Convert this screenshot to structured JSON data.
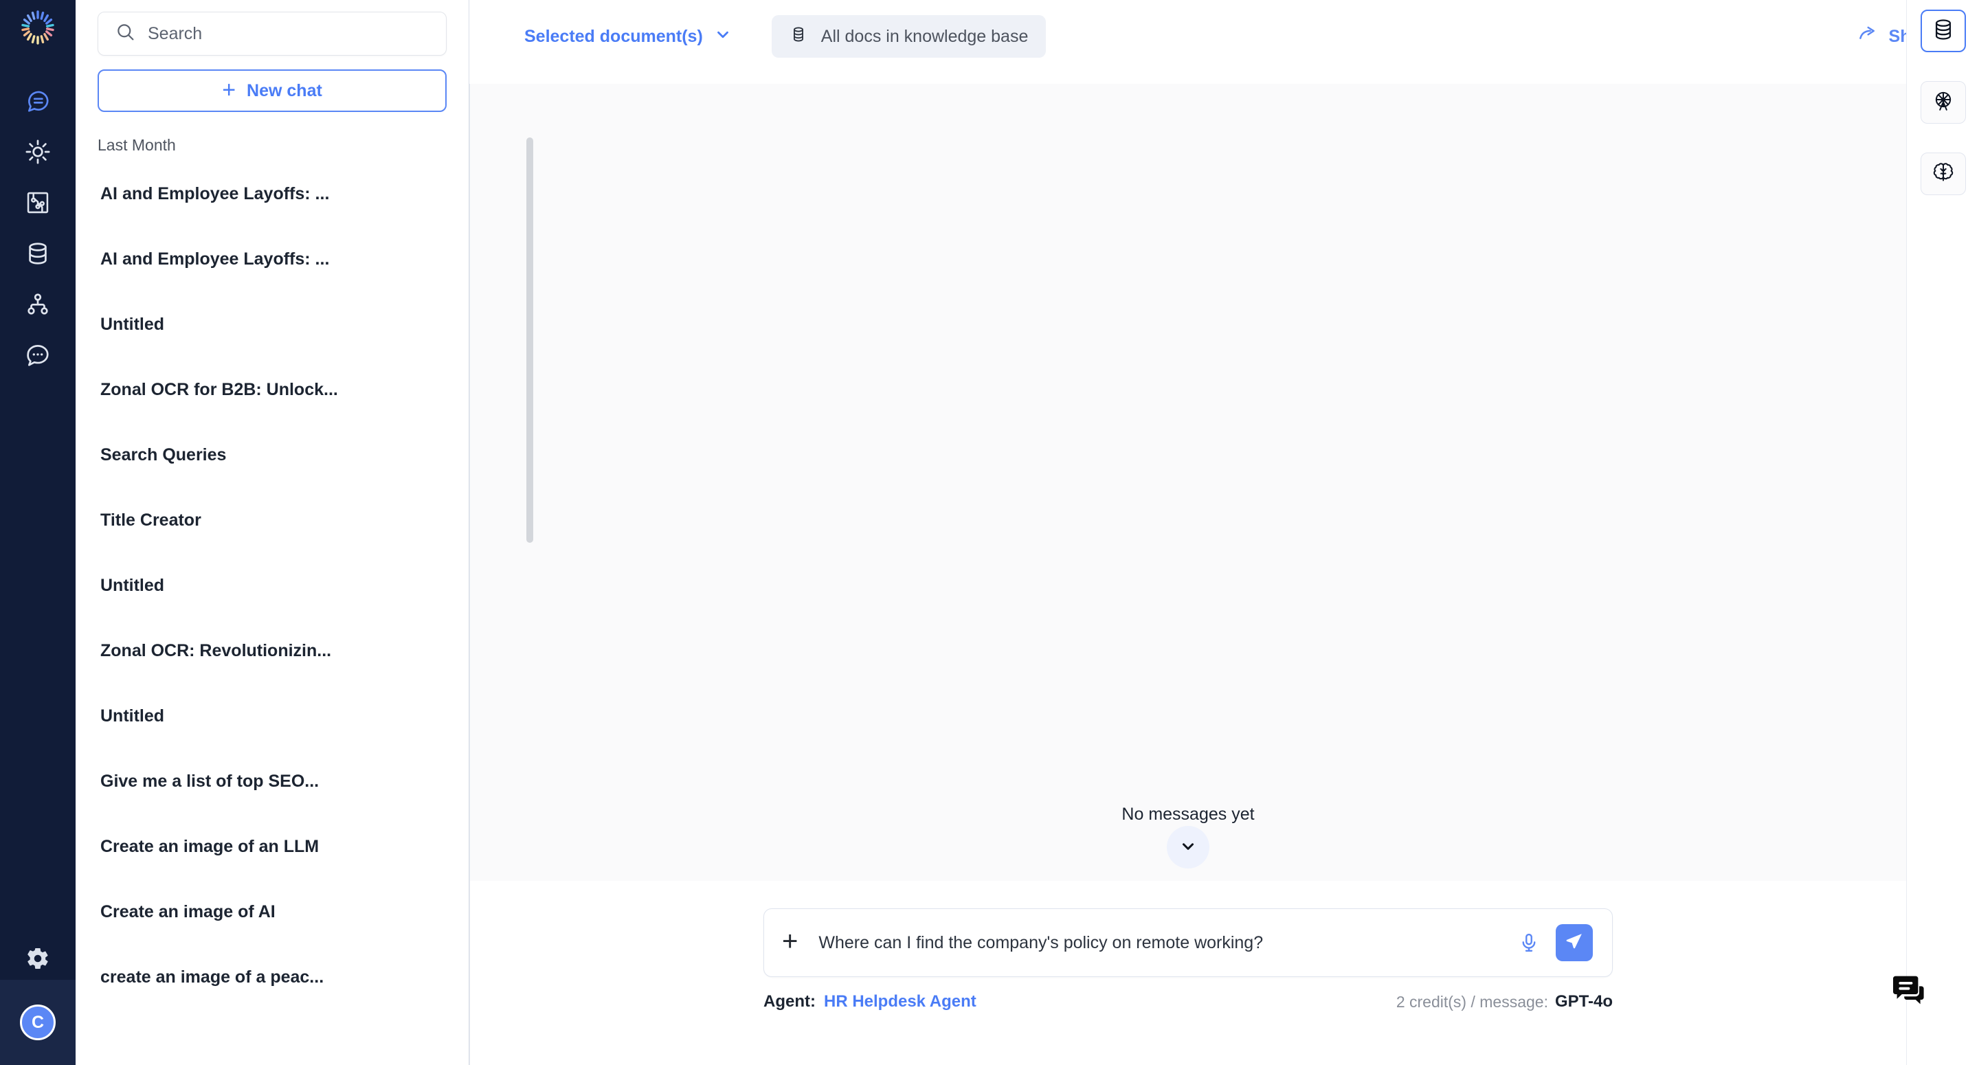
{
  "brand": {
    "logo_icon": "radial-burst-logo",
    "accent": "#4a7cf6",
    "rail_bg": "#111c38"
  },
  "rail": {
    "items": [
      {
        "icon": "chat-lines-icon",
        "name": "nav-chat",
        "active": true
      },
      {
        "icon": "sun-spark-icon",
        "name": "nav-automations",
        "active": false
      },
      {
        "icon": "circuit-board-icon",
        "name": "nav-workflows",
        "active": false
      },
      {
        "icon": "database-icon",
        "name": "nav-knowledge-base",
        "active": false
      },
      {
        "icon": "org-tree-icon",
        "name": "nav-agents",
        "active": false
      },
      {
        "icon": "chat-dots-icon",
        "name": "nav-conversations",
        "active": false
      }
    ],
    "settings_icon": "gear-icon",
    "avatar_initial": "C"
  },
  "search": {
    "placeholder": "Search",
    "value": "",
    "icon": "search-icon"
  },
  "new_chat": {
    "label": "New chat",
    "icon": "plus-icon"
  },
  "chat_history": {
    "section_label": "Last Month",
    "items": [
      {
        "title": "AI and Employee Layoffs: ..."
      },
      {
        "title": "AI and Employee Layoffs: ..."
      },
      {
        "title": "Untitled"
      },
      {
        "title": "Zonal OCR for B2B: Unlock..."
      },
      {
        "title": "Search Queries"
      },
      {
        "title": "Title Creator"
      },
      {
        "title": "Untitled"
      },
      {
        "title": "Zonal OCR: Revolutionizin..."
      },
      {
        "title": "Untitled"
      },
      {
        "title": "Give me a list of top SEO..."
      },
      {
        "title": "Create an image of an LLM"
      },
      {
        "title": "Create an image of AI"
      },
      {
        "title": "create an image of a peac..."
      }
    ]
  },
  "topbar": {
    "selected_documents_label": "Selected document(s)",
    "selected_documents_caret": "chevron-down-icon",
    "knowledge_base_label": "All docs in knowledge base",
    "knowledge_base_icon": "database-icon",
    "share_label": "Share",
    "share_icon": "share-arrow-icon"
  },
  "conversation": {
    "empty_text": "No messages yet",
    "scroll_down_icon": "chevron-down-icon"
  },
  "composer": {
    "add_icon": "plus-icon",
    "placeholder": "Where can I find the company's policy on remote working?",
    "value": "",
    "mic_icon": "microphone-icon",
    "send_icon": "send-paper-plane-icon"
  },
  "footer_meta": {
    "agent_label": "Agent:",
    "agent_name": "HR Helpdesk Agent",
    "credit_text": "2 credit(s) / message:",
    "model_name": "GPT-4o"
  },
  "toolrail": {
    "items": [
      {
        "icon": "database-icon",
        "name": "tool-knowledge-base",
        "active": true
      },
      {
        "icon": "ferris-wheel-icon",
        "name": "tool-playground",
        "active": false
      },
      {
        "icon": "brain-icon",
        "name": "tool-memory",
        "active": false
      }
    ]
  },
  "support_widget": {
    "icon": "chat-bubbles-icon"
  }
}
